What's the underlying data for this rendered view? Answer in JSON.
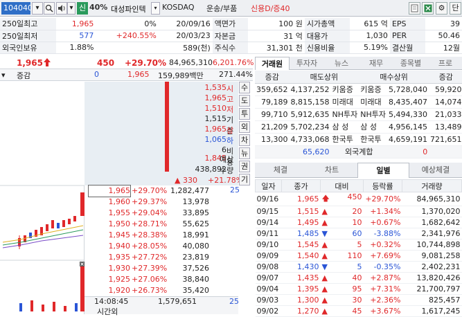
{
  "toolbar": {
    "code": "104040",
    "percent": "40%",
    "name": "대성파인텍",
    "market": "KOSDAQ",
    "sector": "운송/부품",
    "credit": "신용D/증40",
    "sin_label": "신",
    "extra_label": "단"
  },
  "info_rows": [
    [
      "250일최고",
      "1,965",
      "0%",
      "20/09/16",
      "액면가",
      "100 원",
      "시가총액",
      "615 억",
      "EPS",
      "39"
    ],
    [
      "250일최저",
      "577",
      "+240.55%",
      "20/03/23",
      "자본금",
      "31 억",
      "대용가",
      "1,030",
      "PER",
      "50.46"
    ],
    [
      "외국인보유",
      "1.88%",
      "",
      "589(천)",
      "주식수",
      "31,301 천",
      "신용비율",
      "5.19%",
      "결산월",
      "12월"
    ]
  ],
  "quote": {
    "price": "1,965",
    "change": "450",
    "rate": "+29.70%",
    "volume": "84,965,310",
    "vol_rate": "6,201.76%",
    "label_change": "증감",
    "zero": "0",
    "price2": "1,965",
    "amount": "159,989백만",
    "ratio": "271.44%"
  },
  "summary": [
    {
      "value": "1,535",
      "label": "시",
      "cls": "red"
    },
    {
      "value": "1,965",
      "label": "고",
      "cls": "red"
    },
    {
      "value": "1,510",
      "label": "저",
      "cls": "red"
    },
    {
      "value": "1,515",
      "label": "기준",
      "cls": ""
    },
    {
      "value": "1,965",
      "label": "상",
      "cls": "red"
    },
    {
      "value": "1,065",
      "label": "하",
      "cls": "blue"
    },
    {
      "value": "6",
      "label": "비용",
      "cls": ""
    }
  ],
  "expected": {
    "price": "1,845",
    "price_label": "예상",
    "volume": "438,892",
    "volume_label": "수량",
    "change": "330",
    "rate": "+21.78%"
  },
  "side_buttons": [
    "수",
    "도",
    "투",
    "외",
    "차",
    "뉴",
    "권",
    "기"
  ],
  "bids": [
    {
      "price": "1,965",
      "rate": "+29.70%",
      "qty": "1,282,477"
    },
    {
      "price": "1,960",
      "rate": "+29.37%",
      "qty": "13,978"
    },
    {
      "price": "1,955",
      "rate": "+29.04%",
      "qty": "33,895"
    },
    {
      "price": "1,950",
      "rate": "+28.71%",
      "qty": "55,625"
    },
    {
      "price": "1,945",
      "rate": "+28.38%",
      "qty": "18,991"
    },
    {
      "price": "1,940",
      "rate": "+28.05%",
      "qty": "40,080"
    },
    {
      "price": "1,935",
      "rate": "+27.72%",
      "qty": "23,819"
    },
    {
      "price": "1,930",
      "rate": "+27.39%",
      "qty": "37,526"
    },
    {
      "price": "1,925",
      "rate": "+27.06%",
      "qty": "38,840"
    },
    {
      "price": "1,920",
      "rate": "+26.73%",
      "qty": "35,420"
    }
  ],
  "bid_count": "25",
  "bottom": {
    "time": "14:08:45",
    "time_label": "시간외",
    "total": "1,579,651",
    "count": "25"
  },
  "tabs_top": [
    "거래원",
    "투자자",
    "뉴스",
    "재무",
    "종목별",
    "프로"
  ],
  "broker_headers": [
    "증감",
    "매도상위",
    "매수상위",
    "증감"
  ],
  "broker_rows": [
    [
      "359,652",
      "4,137,252",
      "키움증",
      "키움증",
      "5,728,040",
      "59,920"
    ],
    [
      "79,189",
      "8,815,158",
      "미래대",
      "미래대",
      "8,435,407",
      "14,074"
    ],
    [
      "99,710",
      "5,912,635",
      "NH투자",
      "NH투자",
      "5,494,330",
      "21,033"
    ],
    [
      "21,209",
      "5,702,234",
      "삼 성",
      "삼 성",
      "4,956,145",
      "13,489"
    ],
    [
      "13,300",
      "4,733,068",
      "한국투",
      "한국투",
      "4,659,191",
      "721,651"
    ]
  ],
  "foreign": {
    "left": "65,620",
    "label": "외국계합",
    "right": "0"
  },
  "tabs_bottom": [
    "체결",
    "차트",
    "일별",
    "예상체결"
  ],
  "daily_headers": [
    "일자",
    "종가",
    "대비",
    "등락률",
    "거래량"
  ],
  "daily_rows": [
    {
      "date": "09/16",
      "close": "1,965",
      "dir": "up-arrow",
      "diff": "450",
      "rate": "+29.70%",
      "vol": "84,965,310",
      "cls": "red"
    },
    {
      "date": "09/15",
      "close": "1,515",
      "dir": "up",
      "diff": "20",
      "rate": "+1.34%",
      "vol": "1,370,020",
      "cls": "red"
    },
    {
      "date": "09/14",
      "close": "1,495",
      "dir": "up",
      "diff": "10",
      "rate": "+0.67%",
      "vol": "1,682,642",
      "cls": "red"
    },
    {
      "date": "09/11",
      "close": "1,485",
      "dir": "down",
      "diff": "60",
      "rate": "-3.88%",
      "vol": "2,341,976",
      "cls": "blue"
    },
    {
      "date": "09/10",
      "close": "1,545",
      "dir": "up",
      "diff": "5",
      "rate": "+0.32%",
      "vol": "10,744,898",
      "cls": "red"
    },
    {
      "date": "09/09",
      "close": "1,540",
      "dir": "up",
      "diff": "110",
      "rate": "+7.69%",
      "vol": "9,081,258",
      "cls": "red"
    },
    {
      "date": "09/08",
      "close": "1,430",
      "dir": "down",
      "diff": "5",
      "rate": "-0.35%",
      "vol": "2,402,231",
      "cls": "blue"
    },
    {
      "date": "09/07",
      "close": "1,435",
      "dir": "up",
      "diff": "40",
      "rate": "+2.87%",
      "vol": "13,820,426",
      "cls": "red"
    },
    {
      "date": "09/04",
      "close": "1,395",
      "dir": "up",
      "diff": "95",
      "rate": "+7.31%",
      "vol": "21,700,797",
      "cls": "red"
    },
    {
      "date": "09/03",
      "close": "1,300",
      "dir": "up",
      "diff": "30",
      "rate": "+2.36%",
      "vol": "825,457",
      "cls": "red"
    },
    {
      "date": "09/02",
      "close": "1,270",
      "dir": "up",
      "diff": "45",
      "rate": "+3.67%",
      "vol": "1,617,245",
      "cls": "red"
    }
  ],
  "colors": {
    "up": "#e0282a",
    "down": "#2a55d6",
    "accent": "#2f6fc7",
    "sin": "#2a9a5c"
  }
}
